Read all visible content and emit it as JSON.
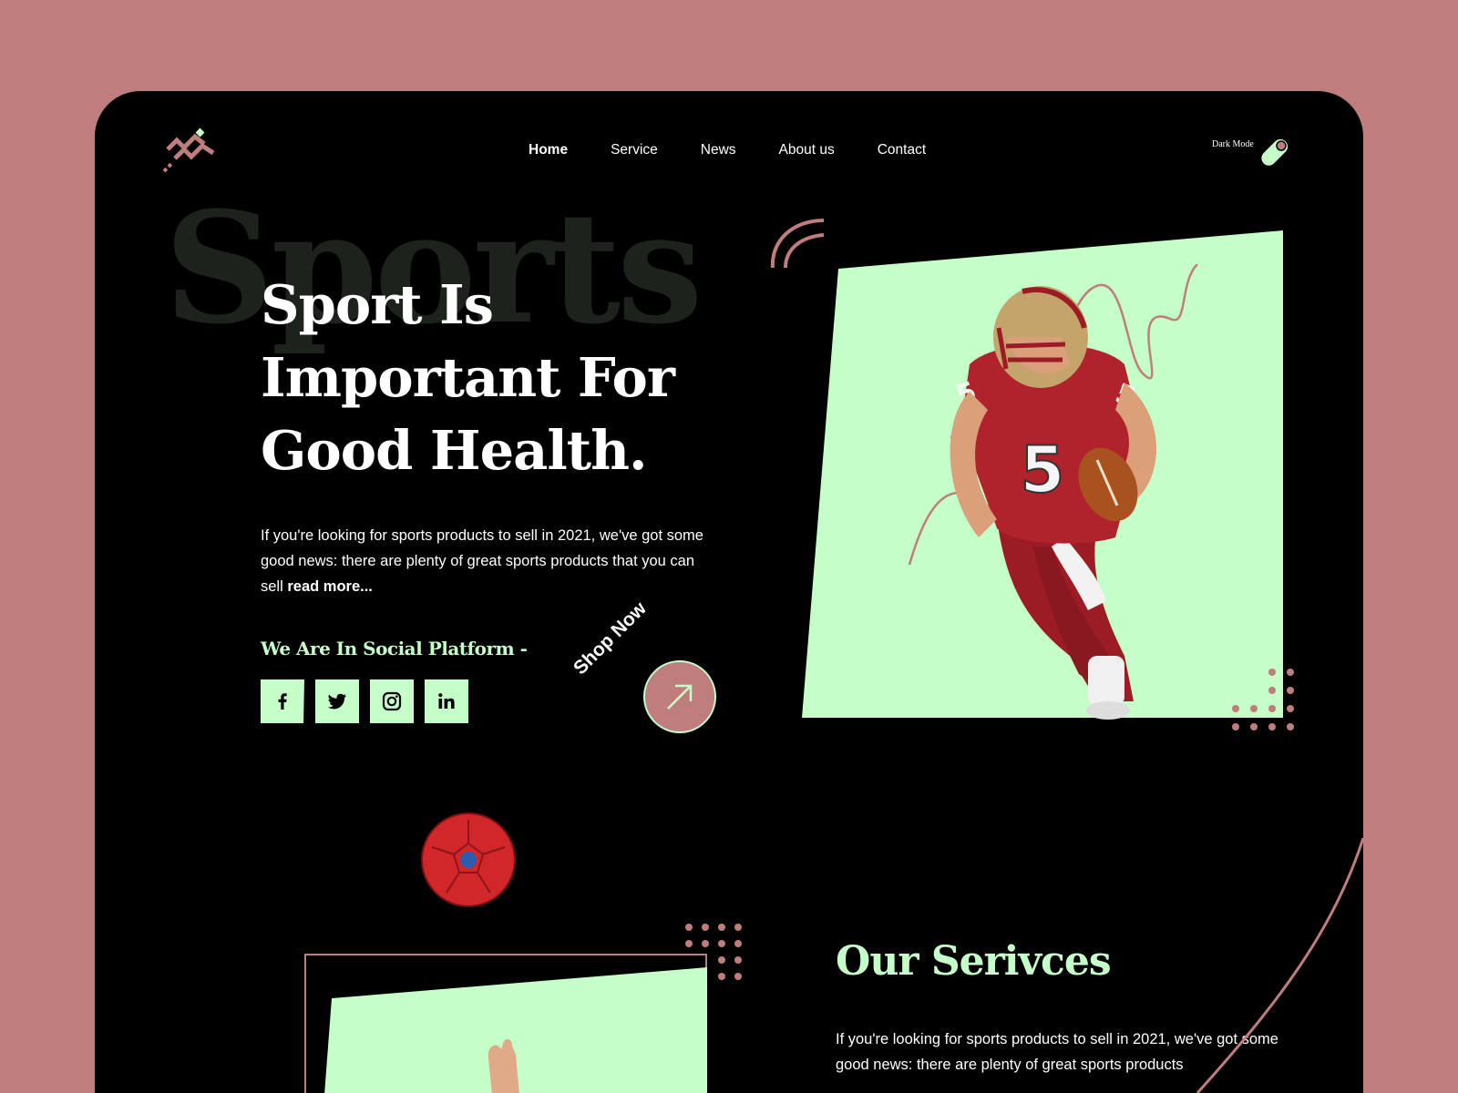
{
  "nav": {
    "items": [
      "Home",
      "Service",
      "News",
      "About us",
      "Contact"
    ],
    "active": "Home",
    "dark_mode_label": "Dark Mode"
  },
  "hero": {
    "background_word": "Sports",
    "headline": "Sport Is Important For Good Health.",
    "intro_text": "If you're looking for sports products to sell in 2021, we've got some good news: there are plenty of great sports products that you can sell ",
    "read_more": "read more...",
    "social_title": "We Are In Social Platform -",
    "social_icons": [
      "facebook-icon",
      "twitter-icon",
      "instagram-icon",
      "linkedin-icon"
    ],
    "shop_now": "Shop Now"
  },
  "services": {
    "title": "Our Serivces",
    "text": "If you're looking for sports products to sell in 2021, we've got some good news: there are plenty of great sports products"
  },
  "colors": {
    "page_bg": "#bf7d7e",
    "frame_bg": "#000000",
    "accent_mint": "#c5fec8",
    "accent_rose": "#bf7d7e"
  }
}
